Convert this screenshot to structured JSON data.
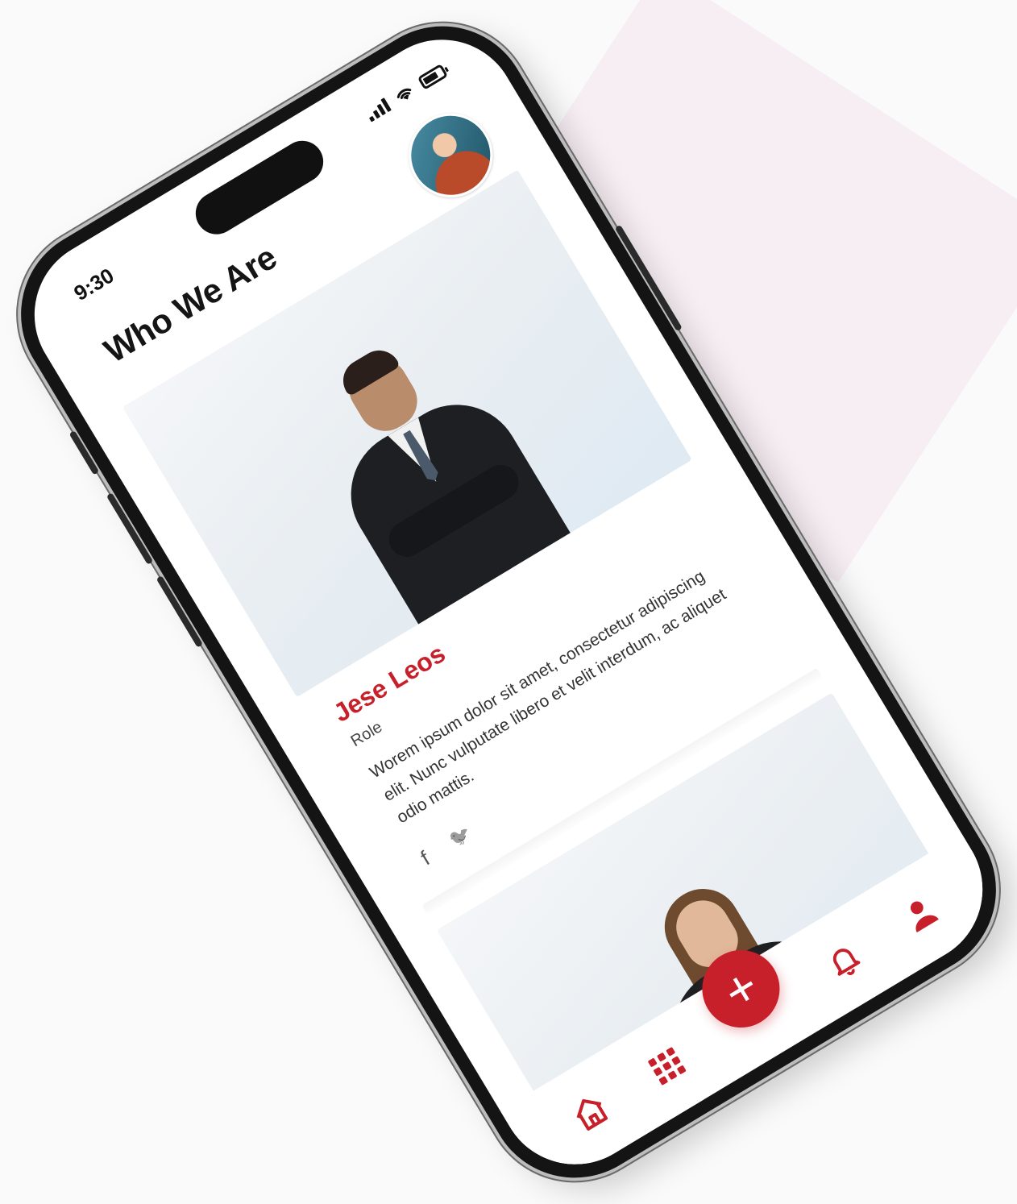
{
  "status_bar": {
    "time": "9:30"
  },
  "header": {
    "title": "Who We Are"
  },
  "team": [
    {
      "name": "Jese Leos",
      "role": "Role",
      "description": "Worem ipsum dolor sit amet, consectetur adipiscing elit. Nunc vulputate libero et velit interdum, ac aliquet odio mattis.",
      "social_facebook_glyph": "f",
      "social_twitter_glyph": "🐦"
    }
  ],
  "tab_bar": {
    "items": [
      "home-icon",
      "grid-icon",
      "add-icon",
      "bell-icon",
      "user-icon"
    ],
    "fab_glyph": "+"
  },
  "colors": {
    "accent": "#c8202a",
    "title": "#151515",
    "text": "#333333"
  }
}
